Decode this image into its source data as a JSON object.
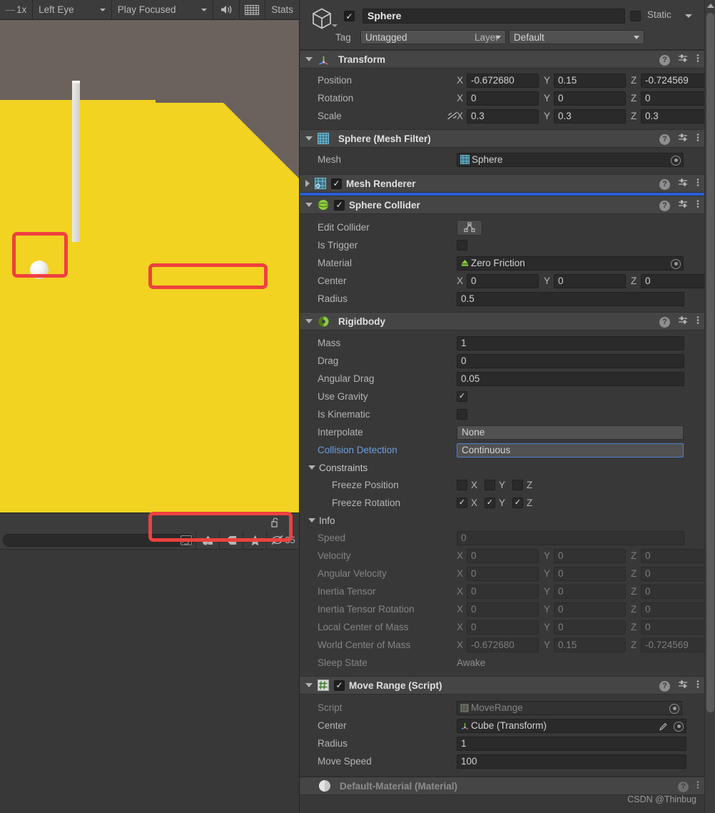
{
  "game_toolbar": {
    "scale": "1x",
    "eye": "Left Eye",
    "focus": "Play Focused",
    "mute_icon": "speaker-icon",
    "gizmos_icon": "keyboard-icon",
    "stats": "Stats"
  },
  "game_view": {
    "floor_color": "#f2d322",
    "sky_color": "#6b625e",
    "pillar_color": "#dcdcd7",
    "sphere_color": "#ffffff",
    "annotation_color": "#ef4040"
  },
  "project_toolbar": {
    "lock_icon": "lock-open-icon",
    "menu_icon": "kebab-menu-icon",
    "search_placeholder": "",
    "popout_icon": "popout-icon",
    "filter_type_icon": "filter-type-icon",
    "filter_label_icon": "filter-label-icon",
    "favorite_icon": "star-icon",
    "visibility_icon": "eye-off-icon",
    "visibility_count": "35"
  },
  "inspector": {
    "object": {
      "enabled": true,
      "name": "Sphere",
      "static_label": "Static",
      "static_checked": false,
      "tag_label": "Tag",
      "tag_value": "Untagged",
      "layer_label": "Layer",
      "layer_value": "Default",
      "icon": "cube-icon"
    },
    "components": [
      {
        "title": "Transform",
        "icon": "transform-icon",
        "expanded": true,
        "has_checkbox": false,
        "rows": [
          {
            "label": "Position",
            "type": "vec3",
            "x": "-0.672680",
            "y": "0.15",
            "z": "-0.724569"
          },
          {
            "label": "Rotation",
            "type": "vec3",
            "x": "0",
            "y": "0",
            "z": "0"
          },
          {
            "label": "Scale",
            "type": "vec3",
            "x": "0.3",
            "y": "0.3",
            "z": "0.3",
            "link_icon": "constrain-proportions-off-icon"
          }
        ]
      },
      {
        "title": "Sphere (Mesh Filter)",
        "icon": "mesh-filter-icon",
        "expanded": true,
        "has_checkbox": false,
        "rows": [
          {
            "label": "Mesh",
            "type": "object",
            "value": "Sphere",
            "icon": "mesh-icon"
          }
        ]
      },
      {
        "title": "Mesh Renderer",
        "icon": "mesh-renderer-icon",
        "expanded": false,
        "has_checkbox": true,
        "checked": true,
        "rows": []
      },
      {
        "title": "Sphere Collider",
        "icon": "sphere-collider-icon",
        "expanded": true,
        "has_checkbox": true,
        "checked": true,
        "rows": [
          {
            "label": "Edit Collider",
            "type": "button",
            "icon": "edit-collider-icon"
          },
          {
            "label": "Is Trigger",
            "type": "bool",
            "value": false
          },
          {
            "label": "Material",
            "type": "object",
            "value": "Zero Friction",
            "icon": "physic-material-icon",
            "highlighted": true
          },
          {
            "label": "Center",
            "type": "vec3",
            "x": "0",
            "y": "0",
            "z": "0"
          },
          {
            "label": "Radius",
            "type": "number",
            "value": "0.5"
          }
        ]
      },
      {
        "title": "Rigidbody",
        "icon": "rigidbody-icon",
        "expanded": true,
        "has_checkbox": false,
        "rows": [
          {
            "label": "Mass",
            "type": "number",
            "value": "1"
          },
          {
            "label": "Drag",
            "type": "number",
            "value": "0"
          },
          {
            "label": "Angular Drag",
            "type": "number",
            "value": "0.05"
          },
          {
            "label": "Use Gravity",
            "type": "bool",
            "value": true
          },
          {
            "label": "Is Kinematic",
            "type": "bool",
            "value": false
          },
          {
            "label": "Interpolate",
            "type": "dropdown",
            "value": "None"
          },
          {
            "label": "Collision Detection",
            "type": "dropdown",
            "value": "Continuous",
            "modified": true
          },
          {
            "label": "Constraints",
            "type": "foldout"
          },
          {
            "label": "Freeze Position",
            "type": "axis-toggles",
            "x": false,
            "y": false,
            "z": false
          },
          {
            "label": "Freeze Rotation",
            "type": "axis-toggles",
            "x": true,
            "y": true,
            "z": true,
            "highlighted": true
          },
          {
            "label": "Info",
            "type": "foldout"
          },
          {
            "label": "Speed",
            "type": "number-ro",
            "value": "0"
          },
          {
            "label": "Velocity",
            "type": "vec3-ro",
            "x": "0",
            "y": "0",
            "z": "0"
          },
          {
            "label": "Angular Velocity",
            "type": "vec3-ro",
            "x": "0",
            "y": "0",
            "z": "0"
          },
          {
            "label": "Inertia Tensor",
            "type": "vec3-ro",
            "x": "0",
            "y": "0",
            "z": "0"
          },
          {
            "label": "Inertia Tensor Rotation",
            "type": "vec3-ro",
            "x": "0",
            "y": "0",
            "z": "0"
          },
          {
            "label": "Local Center of Mass",
            "type": "vec3-ro",
            "x": "0",
            "y": "0",
            "z": "0"
          },
          {
            "label": "World Center of Mass",
            "type": "vec3-ro",
            "x": "-0.672680",
            "y": "0.15",
            "z": "-0.724569"
          },
          {
            "label": "Sleep State",
            "type": "text-ro",
            "value": "Awake"
          }
        ]
      },
      {
        "title": "Move Range (Script)",
        "icon": "script-icon",
        "expanded": true,
        "has_checkbox": true,
        "checked": true,
        "rows": [
          {
            "label": "Script",
            "type": "object-ro",
            "value": "MoveRange",
            "icon": "script-asset-icon"
          },
          {
            "label": "Center",
            "type": "object",
            "value": "Cube (Transform)",
            "icon": "transform-icon",
            "edit_icon": "pencil-icon"
          },
          {
            "label": "Radius",
            "type": "number",
            "value": "1"
          },
          {
            "label": "Move Speed",
            "type": "number",
            "value": "100"
          }
        ]
      },
      {
        "title": "Default-Material (Material)",
        "icon": "material-icon",
        "expanded": false,
        "has_checkbox": false,
        "rows": []
      }
    ],
    "axis_labels": {
      "x": "X",
      "y": "Y",
      "z": "Z"
    },
    "watermark": "CSDN @Thinbug"
  }
}
